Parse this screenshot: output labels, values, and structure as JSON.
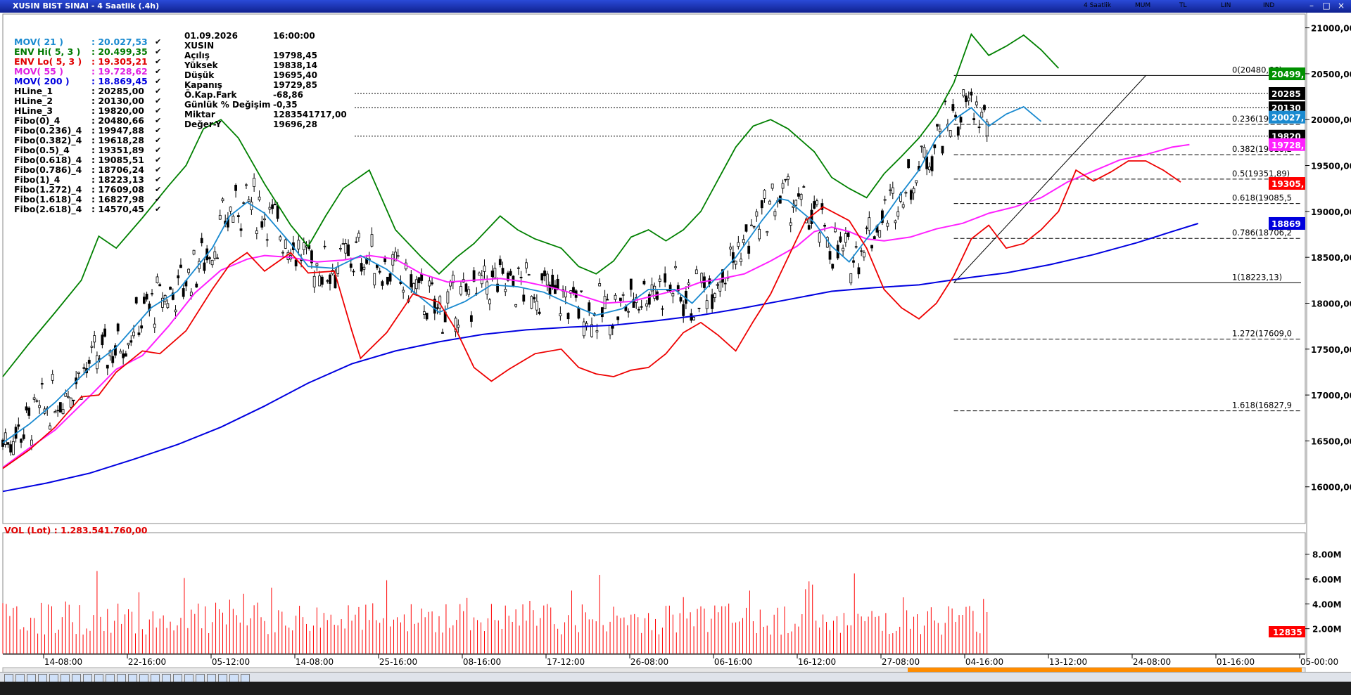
{
  "window": {
    "title": "XUSIN BIST SINAI - 4 Saatlik (.4h)",
    "toolbar": [
      "4 Saatlik",
      "MUM",
      "TL",
      "LIN",
      "IND"
    ]
  },
  "legend": [
    {
      "name": "MOV( 21 )",
      "value": ": 20.027,53",
      "color": "#1a8ad0"
    },
    {
      "name": "ENV Hi( 5, 3 )",
      "value": ": 20.499,35",
      "color": "#007a00"
    },
    {
      "name": "ENV Lo( 5, 3 )",
      "value": ": 19.305,21",
      "color": "#e00000"
    },
    {
      "name": "MOV( 55 )",
      "value": ": 19.728,62",
      "color": "#e020e0"
    },
    {
      "name": "MOV( 200 )",
      "value": ": 18.869,45",
      "color": "#0000e0"
    },
    {
      "name": "HLine_1",
      "value": ": 20285,00",
      "color": "#000000"
    },
    {
      "name": "HLine_2",
      "value": ": 20130,00",
      "color": "#000000"
    },
    {
      "name": "HLine_3",
      "value": ": 19820,00",
      "color": "#000000"
    },
    {
      "name": "Fibo(0)_4",
      "value": ": 20480,66",
      "color": "#000000"
    },
    {
      "name": "Fibo(0.236)_4",
      "value": ": 19947,88",
      "color": "#000000"
    },
    {
      "name": "Fibo(0.382)_4",
      "value": ": 19618,28",
      "color": "#000000"
    },
    {
      "name": "Fibo(0.5)_4",
      "value": ": 19351,89",
      "color": "#000000"
    },
    {
      "name": "Fibo(0.618)_4",
      "value": ": 19085,51",
      "color": "#000000"
    },
    {
      "name": "Fibo(0.786)_4",
      "value": ": 18706,24",
      "color": "#000000"
    },
    {
      "name": "Fibo(1)_4",
      "value": ": 18223,13",
      "color": "#000000"
    },
    {
      "name": "Fibo(1.272)_4",
      "value": ": 17609,08",
      "color": "#000000"
    },
    {
      "name": "Fibo(1.618)_4",
      "value": ": 16827,98",
      "color": "#000000"
    },
    {
      "name": "Fibo(2.618)_4",
      "value": ": 14570,45",
      "color": "#000000"
    }
  ],
  "legend_check": "✔",
  "info": [
    {
      "k": "01.09.2026",
      "v": "16:00:00"
    },
    {
      "k": "XUSIN",
      "v": ""
    },
    {
      "k": "Açılış",
      "v": "19798,45"
    },
    {
      "k": "Yüksek",
      "v": "19838,14"
    },
    {
      "k": "Düşük",
      "v": "19695,40"
    },
    {
      "k": "Kapanış",
      "v": "19729,85"
    },
    {
      "k": "Ö.Kap.Fark",
      "v": "-68,86"
    },
    {
      "k": "Günlük % Değişim",
      "v": "-0,35"
    },
    {
      "k": "Miktar",
      "v": "1283541717,00"
    },
    {
      "k": "Değer-Y",
      "v": "19696,28"
    }
  ],
  "volume_label": "VOL (Lot) : 1.283.541.760,00",
  "chart_data": {
    "type": "candlestick",
    "x_tick_labels": [
      "14-08:00",
      "22-16:00",
      "05-12:00",
      "14-08:00",
      "25-16:00",
      "08-16:00",
      "17-12:00",
      "26-08:00",
      "06-16:00",
      "16-12:00",
      "27-08:00",
      "04-16:00",
      "13-12:00",
      "24-08:00",
      "01-16:00",
      "05-00:00"
    ],
    "y_tick_labels": [
      "21000,00",
      "20500,00",
      "20000,00",
      "19500,00",
      "19000,00",
      "18500,00",
      "18000,00",
      "17500,00",
      "17000,00",
      "16500,00",
      "16000,00"
    ],
    "ylim": [
      15600,
      21150
    ],
    "price_tags": [
      {
        "text": "20499,",
        "value": 20499,
        "bg": "#009000",
        "fg": "#ffffff"
      },
      {
        "text": "20285",
        "value": 20285,
        "bg": "#000000",
        "fg": "#ffffff"
      },
      {
        "text": "20130",
        "value": 20130,
        "bg": "#000000",
        "fg": "#ffffff"
      },
      {
        "text": "20027,",
        "value": 20027,
        "bg": "#1a8ad0",
        "fg": "#ffffff"
      },
      {
        "text": "19820",
        "value": 19820,
        "bg": "#000000",
        "fg": "#ffffff"
      },
      {
        "text": "19728,",
        "value": 19728,
        "bg": "#ff20ff",
        "fg": "#ffffff"
      },
      {
        "text": "19305,",
        "value": 19305,
        "bg": "#ff0000",
        "fg": "#ffffff"
      },
      {
        "text": "18869",
        "value": 18869,
        "bg": "#0000dd",
        "fg": "#ffffff"
      }
    ],
    "fibo": [
      {
        "label": "0(20480,66)",
        "value": 20480.66
      },
      {
        "label": "0.236(19947,8",
        "value": 19947.88
      },
      {
        "label": "0.382(19618,2",
        "value": 19618.28
      },
      {
        "label": "0.5(19351,89)",
        "value": 19351.89
      },
      {
        "label": "0.618(19085,5",
        "value": 19085.51
      },
      {
        "label": "0.786(18706,2",
        "value": 18706.24
      },
      {
        "label": "1(18223,13)",
        "value": 18223.13
      },
      {
        "label": "1.272(17609,0",
        "value": 17609.08
      },
      {
        "label": "1.618(16827,9",
        "value": 16827.98
      }
    ],
    "hlines": [
      20285,
      20130,
      19820
    ],
    "series": {
      "mov21": [
        [
          0,
          16480
        ],
        [
          30,
          16680
        ],
        [
          60,
          16920
        ],
        [
          100,
          17300
        ],
        [
          130,
          17520
        ],
        [
          170,
          17950
        ],
        [
          200,
          18130
        ],
        [
          240,
          18600
        ],
        [
          260,
          18950
        ],
        [
          280,
          19100
        ],
        [
          300,
          18980
        ],
        [
          330,
          18650
        ],
        [
          350,
          18400
        ],
        [
          380,
          18380
        ],
        [
          410,
          18520
        ],
        [
          440,
          18370
        ],
        [
          470,
          18130
        ],
        [
          500,
          17900
        ],
        [
          530,
          18020
        ],
        [
          560,
          18200
        ],
        [
          590,
          18180
        ],
        [
          620,
          18120
        ],
        [
          650,
          17990
        ],
        [
          680,
          17870
        ],
        [
          710,
          17940
        ],
        [
          740,
          18150
        ],
        [
          770,
          18150
        ],
        [
          790,
          18000
        ],
        [
          810,
          18200
        ],
        [
          840,
          18500
        ],
        [
          870,
          18900
        ],
        [
          890,
          19140
        ],
        [
          900,
          19120
        ],
        [
          930,
          18880
        ],
        [
          950,
          18620
        ],
        [
          970,
          18450
        ],
        [
          990,
          18700
        ],
        [
          1010,
          18930
        ],
        [
          1030,
          19200
        ],
        [
          1050,
          19450
        ],
        [
          1070,
          19800
        ],
        [
          1090,
          20000
        ],
        [
          1110,
          20130
        ],
        [
          1130,
          19930
        ],
        [
          1150,
          20060
        ],
        [
          1170,
          20140
        ],
        [
          1190,
          19980
        ]
      ],
      "env_hi": [
        [
          0,
          17200
        ],
        [
          30,
          17560
        ],
        [
          60,
          17900
        ],
        [
          90,
          18250
        ],
        [
          110,
          18730
        ],
        [
          130,
          18600
        ],
        [
          160,
          18930
        ],
        [
          190,
          19280
        ],
        [
          210,
          19500
        ],
        [
          230,
          19900
        ],
        [
          250,
          20000
        ],
        [
          270,
          19800
        ],
        [
          300,
          19300
        ],
        [
          330,
          18850
        ],
        [
          350,
          18620
        ],
        [
          370,
          18950
        ],
        [
          390,
          19250
        ],
        [
          420,
          19450
        ],
        [
          450,
          18800
        ],
        [
          480,
          18500
        ],
        [
          500,
          18320
        ],
        [
          520,
          18500
        ],
        [
          540,
          18650
        ],
        [
          570,
          18950
        ],
        [
          590,
          18800
        ],
        [
          610,
          18700
        ],
        [
          640,
          18600
        ],
        [
          660,
          18400
        ],
        [
          680,
          18320
        ],
        [
          700,
          18460
        ],
        [
          720,
          18720
        ],
        [
          740,
          18800
        ],
        [
          760,
          18680
        ],
        [
          780,
          18800
        ],
        [
          800,
          19000
        ],
        [
          820,
          19350
        ],
        [
          840,
          19700
        ],
        [
          860,
          19930
        ],
        [
          880,
          20000
        ],
        [
          900,
          19900
        ],
        [
          930,
          19650
        ],
        [
          950,
          19370
        ],
        [
          970,
          19250
        ],
        [
          990,
          19150
        ],
        [
          1010,
          19410
        ],
        [
          1030,
          19600
        ],
        [
          1050,
          19800
        ],
        [
          1070,
          20050
        ],
        [
          1090,
          20400
        ],
        [
          1110,
          20930
        ],
        [
          1130,
          20700
        ],
        [
          1150,
          20800
        ],
        [
          1170,
          20920
        ],
        [
          1190,
          20760
        ],
        [
          1210,
          20560
        ]
      ],
      "env_lo": [
        [
          0,
          16200
        ],
        [
          30,
          16400
        ],
        [
          60,
          16650
        ],
        [
          90,
          16980
        ],
        [
          110,
          17000
        ],
        [
          130,
          17250
        ],
        [
          160,
          17480
        ],
        [
          180,
          17450
        ],
        [
          210,
          17700
        ],
        [
          240,
          18150
        ],
        [
          260,
          18420
        ],
        [
          280,
          18550
        ],
        [
          300,
          18350
        ],
        [
          330,
          18550
        ],
        [
          350,
          18330
        ],
        [
          380,
          18350
        ],
        [
          400,
          17700
        ],
        [
          410,
          17400
        ],
        [
          440,
          17680
        ],
        [
          470,
          18100
        ],
        [
          500,
          18010
        ],
        [
          520,
          17700
        ],
        [
          540,
          17300
        ],
        [
          560,
          17150
        ],
        [
          580,
          17280
        ],
        [
          610,
          17450
        ],
        [
          640,
          17500
        ],
        [
          660,
          17300
        ],
        [
          680,
          17230
        ],
        [
          700,
          17200
        ],
        [
          720,
          17270
        ],
        [
          740,
          17300
        ],
        [
          760,
          17450
        ],
        [
          780,
          17680
        ],
        [
          800,
          17790
        ],
        [
          820,
          17650
        ],
        [
          840,
          17480
        ],
        [
          860,
          17800
        ],
        [
          880,
          18100
        ],
        [
          900,
          18500
        ],
        [
          920,
          18900
        ],
        [
          940,
          19050
        ],
        [
          970,
          18900
        ],
        [
          990,
          18600
        ],
        [
          1010,
          18150
        ],
        [
          1030,
          17950
        ],
        [
          1050,
          17830
        ],
        [
          1070,
          18000
        ],
        [
          1090,
          18300
        ],
        [
          1110,
          18700
        ],
        [
          1130,
          18850
        ],
        [
          1150,
          18600
        ],
        [
          1170,
          18650
        ],
        [
          1190,
          18800
        ],
        [
          1210,
          19000
        ],
        [
          1230,
          19450
        ],
        [
          1250,
          19330
        ],
        [
          1270,
          19430
        ],
        [
          1290,
          19550
        ],
        [
          1310,
          19550
        ],
        [
          1330,
          19450
        ],
        [
          1350,
          19320
        ]
      ],
      "mov55": [
        [
          0,
          16210
        ],
        [
          30,
          16420
        ],
        [
          60,
          16620
        ],
        [
          100,
          16990
        ],
        [
          130,
          17280
        ],
        [
          160,
          17430
        ],
        [
          190,
          17750
        ],
        [
          220,
          18110
        ],
        [
          250,
          18360
        ],
        [
          280,
          18480
        ],
        [
          300,
          18520
        ],
        [
          330,
          18500
        ],
        [
          360,
          18450
        ],
        [
          390,
          18470
        ],
        [
          420,
          18520
        ],
        [
          450,
          18480
        ],
        [
          480,
          18320
        ],
        [
          510,
          18230
        ],
        [
          540,
          18250
        ],
        [
          570,
          18270
        ],
        [
          600,
          18230
        ],
        [
          630,
          18170
        ],
        [
          660,
          18090
        ],
        [
          690,
          18000
        ],
        [
          720,
          18020
        ],
        [
          750,
          18090
        ],
        [
          780,
          18160
        ],
        [
          800,
          18230
        ],
        [
          820,
          18260
        ],
        [
          850,
          18320
        ],
        [
          880,
          18460
        ],
        [
          910,
          18620
        ],
        [
          930,
          18780
        ],
        [
          950,
          18830
        ],
        [
          970,
          18780
        ],
        [
          990,
          18700
        ],
        [
          1010,
          18680
        ],
        [
          1040,
          18720
        ],
        [
          1070,
          18810
        ],
        [
          1100,
          18870
        ],
        [
          1130,
          18980
        ],
        [
          1160,
          19050
        ],
        [
          1190,
          19150
        ],
        [
          1220,
          19320
        ],
        [
          1250,
          19440
        ],
        [
          1280,
          19560
        ],
        [
          1310,
          19620
        ],
        [
          1340,
          19700
        ],
        [
          1360,
          19728
        ]
      ],
      "mov200": [
        [
          0,
          15950
        ],
        [
          50,
          16040
        ],
        [
          100,
          16150
        ],
        [
          150,
          16300
        ],
        [
          200,
          16460
        ],
        [
          250,
          16650
        ],
        [
          300,
          16880
        ],
        [
          350,
          17130
        ],
        [
          400,
          17340
        ],
        [
          450,
          17480
        ],
        [
          500,
          17580
        ],
        [
          550,
          17660
        ],
        [
          600,
          17710
        ],
        [
          650,
          17740
        ],
        [
          700,
          17760
        ],
        [
          750,
          17810
        ],
        [
          800,
          17870
        ],
        [
          850,
          17950
        ],
        [
          900,
          18040
        ],
        [
          950,
          18130
        ],
        [
          1000,
          18170
        ],
        [
          1050,
          18200
        ],
        [
          1100,
          18270
        ],
        [
          1150,
          18330
        ],
        [
          1200,
          18420
        ],
        [
          1250,
          18530
        ],
        [
          1300,
          18660
        ],
        [
          1340,
          18780
        ],
        [
          1370,
          18869
        ]
      ]
    }
  },
  "volume_axis": [
    "8.00M",
    "6.00M",
    "4.00M",
    "2.00M"
  ],
  "volume_tag": "12835"
}
